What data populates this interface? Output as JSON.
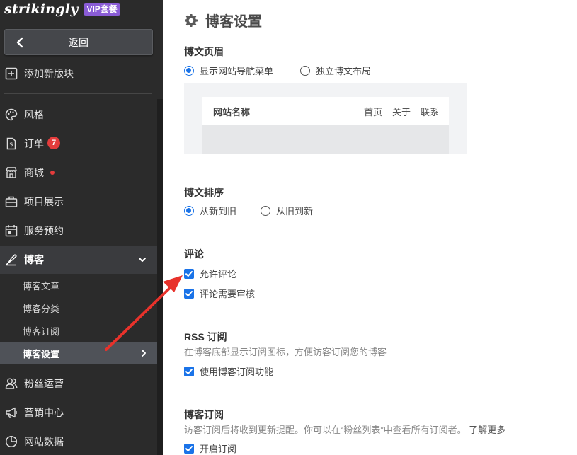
{
  "brand": {
    "logo_text": "strikingly",
    "plan_badge": "VIP套餐"
  },
  "sidebar": {
    "back_label": "返回",
    "add_section_label": "添加新版块",
    "items": [
      {
        "label": "风格",
        "icon": "palette-icon"
      },
      {
        "label": "订单",
        "icon": "dollar-doc-icon",
        "badge": "7"
      },
      {
        "label": "商城",
        "icon": "store-icon"
      },
      {
        "label": "项目展示",
        "icon": "briefcase-icon"
      },
      {
        "label": "服务预约",
        "icon": "calendar-icon"
      },
      {
        "label": "博客",
        "icon": "pen-icon"
      }
    ],
    "blog_sub_items": [
      {
        "label": "博客文章"
      },
      {
        "label": "博客分类"
      },
      {
        "label": "博客订阅"
      },
      {
        "label": "博客设置"
      }
    ],
    "bottom_items": [
      {
        "label": "粉丝运营",
        "icon": "users-icon"
      },
      {
        "label": "营销中心",
        "icon": "megaphone-icon"
      },
      {
        "label": "网站数据",
        "icon": "pie-chart-icon"
      }
    ]
  },
  "main": {
    "title": "博客设置",
    "post_header": {
      "title": "博文页眉",
      "options": [
        "显示网站导航菜单",
        "独立博文布局"
      ],
      "selected": 0,
      "preview": {
        "site_name": "网站名称",
        "links": [
          "首页",
          "关于",
          "联系"
        ]
      }
    },
    "post_order": {
      "title": "博文排序",
      "options": [
        "从新到旧",
        "从旧到新"
      ],
      "selected": 0
    },
    "comments": {
      "title": "评论",
      "options": [
        {
          "label": "允许评论",
          "checked": true
        },
        {
          "label": "评论需要审核",
          "checked": true
        }
      ]
    },
    "rss": {
      "title": "RSS 订阅",
      "desc": "在博客底部显示订阅图标，方便访客订阅您的博客",
      "option": {
        "label": "使用博客订阅功能",
        "checked": true
      }
    },
    "subscribe": {
      "title": "博客订阅",
      "desc": "访客订阅后将收到更新提醒。你可以在“粉丝列表”中查看所有订阅者。",
      "link": "了解更多",
      "option": {
        "label": "开启订阅",
        "checked": true
      }
    }
  },
  "colors": {
    "accent": "#1a73e8",
    "sidebar_bg": "#2b2b2b",
    "badge_red": "#e43c3c",
    "vip_purple": "#8a5cd6",
    "annotation_arrow": "#e8322b"
  }
}
